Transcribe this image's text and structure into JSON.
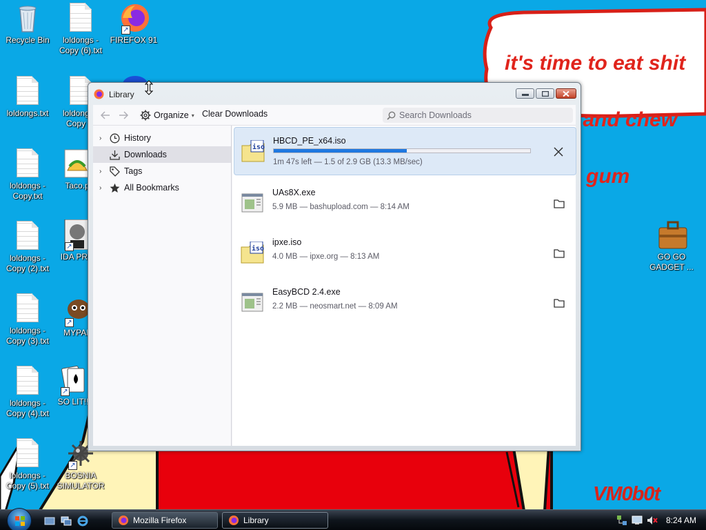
{
  "wallpaper": {
    "speech_lines": [
      "it's time to eat shit",
      "and die and chew",
      "gum"
    ],
    "watermark": "VM0b0t",
    "colors": {
      "sky": "#0aa8e6",
      "text_red": "#e0241c",
      "yellow": "#fff4b8",
      "red_body": "#e8000c"
    }
  },
  "desktop_icons": [
    {
      "label": "Recycle Bin",
      "icon": "recycle-bin-icon"
    },
    {
      "label": "loldongs - Copy (6).txt",
      "icon": "text-file-icon"
    },
    {
      "label": "FIREFOX 91",
      "icon": "firefox-icon"
    },
    {
      "label": "loldongs.txt",
      "icon": "text-file-icon"
    },
    {
      "label": "loldongs - Copy (7",
      "icon": "text-file-icon"
    },
    {
      "label": "loldongs - Copy.txt",
      "icon": "text-file-icon"
    },
    {
      "label": "Taco.p",
      "icon": "taco-image-icon"
    },
    {
      "label": "loldongs - Copy (2).txt",
      "icon": "text-file-icon"
    },
    {
      "label": "IDA PRO",
      "icon": "ida-pro-icon"
    },
    {
      "label": "loldongs - Copy (3).txt",
      "icon": "text-file-icon"
    },
    {
      "label": "MYPAL",
      "icon": "mypal-icon"
    },
    {
      "label": "loldongs - Copy (4).txt",
      "icon": "text-file-icon"
    },
    {
      "label": "SO LIT!!",
      "icon": "solitaire-icon"
    },
    {
      "label": "loldongs - Copy (5).txt",
      "icon": "text-file-icon"
    },
    {
      "label": "BOSNIA SIMULATOR",
      "icon": "mine-icon"
    },
    {
      "label": "GO GO GADGET ...",
      "icon": "briefcase-icon"
    }
  ],
  "window": {
    "title": "Library",
    "controls": [
      "minimize-icon",
      "maximize-icon",
      "close-icon"
    ],
    "toolbar": {
      "organize_label": "Organize",
      "clear_label": "Clear Downloads",
      "search_placeholder": "Search Downloads"
    },
    "sidebar": [
      {
        "label": "History",
        "icon": "clock-icon",
        "expandable": true,
        "selected": false
      },
      {
        "label": "Downloads",
        "icon": "download-icon",
        "expandable": false,
        "selected": true
      },
      {
        "label": "Tags",
        "icon": "tag-icon",
        "expandable": true,
        "selected": false
      },
      {
        "label": "All Bookmarks",
        "icon": "star-icon",
        "expandable": true,
        "selected": false
      }
    ],
    "downloads": [
      {
        "name": "HBCD_PE_x64.iso",
        "status": "1m 47s left — 1.5 of 2.9 GB (13.3 MB/sec)",
        "progress": 0.52,
        "in_progress": true,
        "file_icon": "iso-file-icon",
        "action_icon": "cancel-icon"
      },
      {
        "name": "UAs8X.exe",
        "status": "5.9 MB — bashupload.com — 8:14 AM",
        "in_progress": false,
        "file_icon": "exe-file-icon",
        "action_icon": "folder-icon"
      },
      {
        "name": "ipxe.iso",
        "status": "4.0 MB — ipxe.org — 8:13 AM",
        "in_progress": false,
        "file_icon": "iso-file-icon",
        "action_icon": "folder-icon"
      },
      {
        "name": "EasyBCD 2.4.exe",
        "status": "2.2 MB — neosmart.net — 8:09 AM",
        "in_progress": false,
        "file_icon": "exe-file-icon",
        "action_icon": "folder-icon"
      }
    ]
  },
  "taskbar": {
    "buttons": [
      {
        "label": "Mozilla Firefox",
        "icon": "firefox-icon",
        "active": false
      },
      {
        "label": "Library",
        "icon": "firefox-icon",
        "active": true
      }
    ],
    "quick_launch": [
      "show-desktop-icon",
      "switch-windows-icon",
      "internet-explorer-icon"
    ],
    "tray_icons": [
      "network-icon",
      "display-icon",
      "volume-muted-icon"
    ],
    "clock": "8:24 AM"
  }
}
